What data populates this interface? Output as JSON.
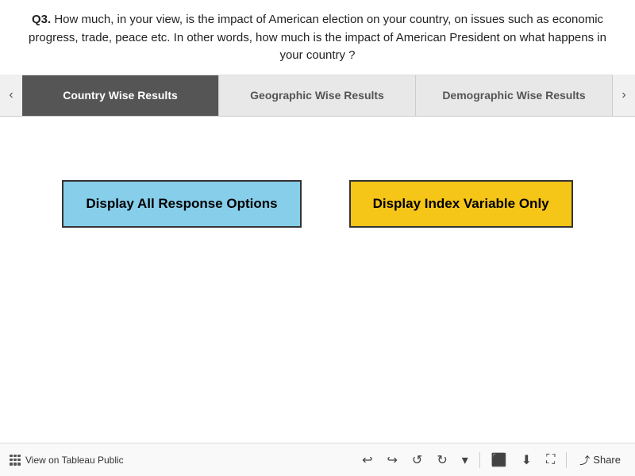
{
  "question": {
    "prefix": "Q3.",
    "text": " How much, in your view, is the impact of American election on your country, on issues such as economic progress, trade, peace etc. In other words, how much is the impact of American President on what happens in your country ?"
  },
  "tabs": [
    {
      "id": "country",
      "label": "Country Wise Results",
      "active": true
    },
    {
      "id": "geographic",
      "label": "Geographic Wise Results",
      "active": false
    },
    {
      "id": "demographic",
      "label": "Demographic Wise Results",
      "active": false
    }
  ],
  "buttons": {
    "display_all": "Display All Response Options",
    "display_index": "Display Index Variable Only"
  },
  "toolbar": {
    "brand_label": "View on Tableau Public",
    "share_label": "Share"
  },
  "arrows": {
    "left": "‹",
    "right": "›"
  }
}
